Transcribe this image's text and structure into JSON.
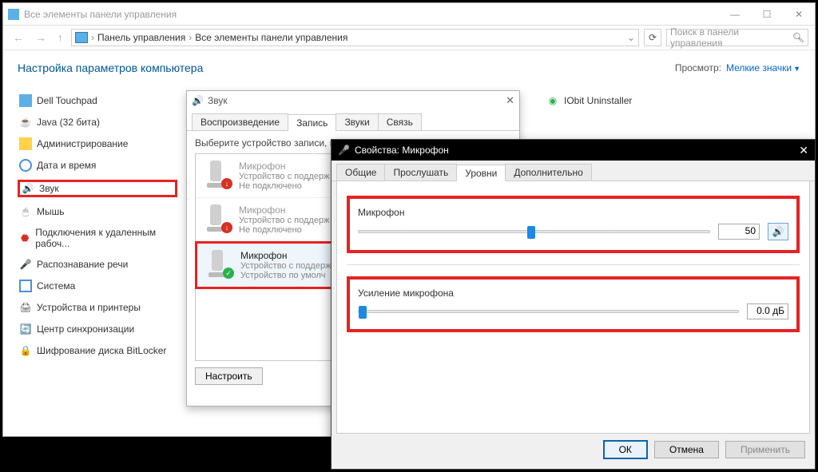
{
  "window": {
    "title": "Все элементы панели управления"
  },
  "breadcrumb": {
    "item1": "Панель управления",
    "item2": "Все элементы панели управления"
  },
  "search": {
    "placeholder": "Поиск в панели управления"
  },
  "header": {
    "title": "Настройка параметров компьютера",
    "view_label": "Просмотр:",
    "view_value": "Мелкие значки"
  },
  "items": {
    "col1": [
      "Dell Touchpad",
      "Java (32 бита)",
      "Администрирование",
      "Дата и время",
      "Звук",
      "Мышь",
      "Подключения к удаленным рабоч...",
      "Распознавание речи",
      "Система",
      "Устройства и принтеры",
      "Центр синхронизации",
      "Шифрование диска BitLocker"
    ],
    "iobit": "IObit Uninstaller"
  },
  "sound": {
    "title": "Звук",
    "tabs": [
      "Воспроизведение",
      "Запись",
      "Звуки",
      "Связь"
    ],
    "hint": "Выберите устройство записи, пар",
    "dev": {
      "name": "Микрофон",
      "sub_unsupported": "Устройство с поддерж",
      "sub_notconn": "Не подключено",
      "sub_default": "Устройство по умолч"
    },
    "configure": "Настроить"
  },
  "props": {
    "title": "Свойства: Микрофон",
    "tabs": [
      "Общие",
      "Прослушать",
      "Уровни",
      "Дополнительно"
    ],
    "mic": {
      "label": "Микрофон",
      "value": "50"
    },
    "boost": {
      "label": "Усиление микрофона",
      "value": "0.0 дБ"
    },
    "ok": "ОК",
    "cancel": "Отмена",
    "apply": "Применить"
  }
}
